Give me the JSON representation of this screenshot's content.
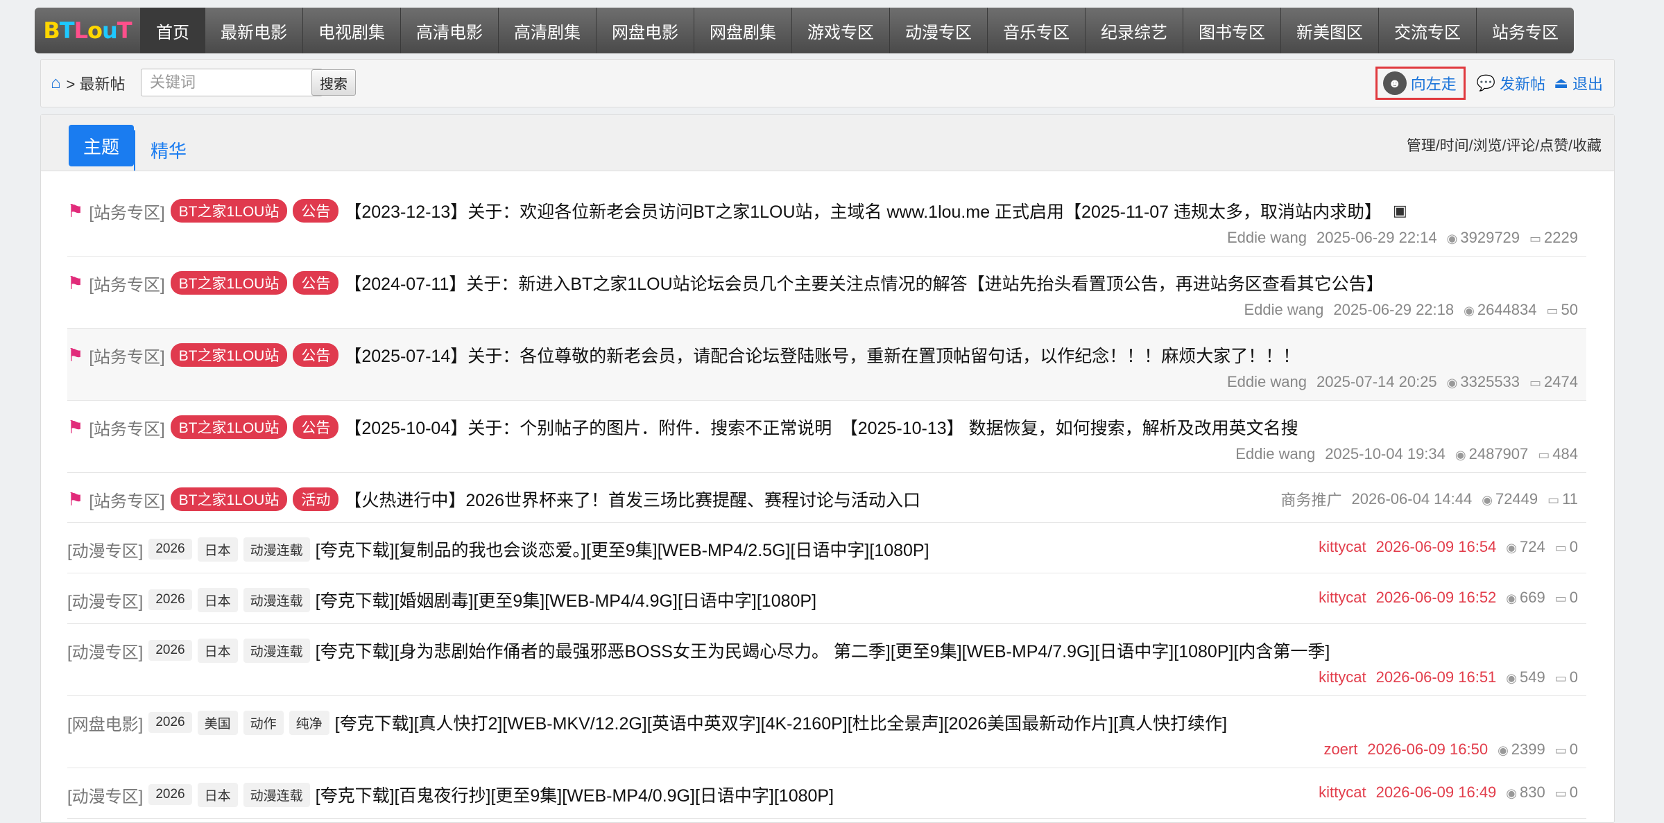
{
  "nav": {
    "items": [
      "首页",
      "最新电影",
      "电视剧集",
      "高清电影",
      "高清剧集",
      "网盘电影",
      "网盘剧集",
      "游戏专区",
      "动漫专区",
      "音乐专区",
      "纪录综艺",
      "图书专区",
      "新美图区",
      "交流专区",
      "站务专区"
    ]
  },
  "toolbar": {
    "breadcrumb": "> 最新帖",
    "search_placeholder": "关键词",
    "search_button": "搜索",
    "link_left": "向左走",
    "link_post": "发新帖",
    "link_logout": "退出"
  },
  "tabs": {
    "active": "主题",
    "other": "精华",
    "sort_links": "管理/时间/浏览/评论/点赞/收藏"
  },
  "threads": [
    {
      "forum": "[站务专区]",
      "pill": "BT之家1LOU站",
      "type": "公告",
      "title": "【2023-12-13】关于：欢迎各位新老会员访问BT之家1LOU站，主域名 www.1lou.me 正式启用【2025-11-07 违规太多，取消站内求助】",
      "author": "Eddie wang",
      "time": "2025-06-29 22:14",
      "views": "3929729",
      "replies": "2229"
    },
    {
      "forum": "[站务专区]",
      "pill": "BT之家1LOU站",
      "type": "公告",
      "title": "【2024-07-11】关于：新进入BT之家1LOU站论坛会员几个主要关注点情况的解答【进站先抬头看置顶公告，再进站务区查看其它公告】",
      "author": "Eddie wang",
      "time": "2025-06-29 22:18",
      "views": "2644834",
      "replies": "50"
    },
    {
      "forum": "[站务专区]",
      "pill": "BT之家1LOU站",
      "type": "公告",
      "title": "【2025-07-14】关于：各位尊敬的新老会员，请配合论坛登陆账号，重新在置顶帖留句话，以作纪念！！！麻烦大家了！！！",
      "author": "Eddie wang",
      "time": "2025-07-14 20:25",
      "views": "3325533",
      "replies": "2474"
    },
    {
      "forum": "[站务专区]",
      "pill": "BT之家1LOU站",
      "type": "公告",
      "title": "【2025-10-04】关于：个别帖子的图片．附件．搜索不正常说明　【2025-10-13】 数据恢复，如何搜索，解析及改用英文名搜",
      "author": "Eddie wang",
      "time": "2025-10-04 19:34",
      "views": "2487907",
      "replies": "484"
    },
    {
      "forum": "[站务专区]",
      "pill": "BT之家1LOU站",
      "type": "活动",
      "title": "【火热进行中】2026世界杯来了！首发三场比赛提醒、赛程讨论与活动入口",
      "author": "商务推广",
      "time": "2026-06-04 14:44",
      "views": "72449",
      "replies": "11"
    },
    {
      "forum": "[动漫专区]",
      "tags": [
        "2026",
        "日本",
        "动漫连载"
      ],
      "title": "[夸克下载][复制品的我也会谈恋爱。][更至9集][WEB-MP4/2.5G][日语中字][1080P]",
      "author": "kittycat",
      "time": "2026-06-09 16:54",
      "views": "724",
      "replies": "0"
    },
    {
      "forum": "[动漫专区]",
      "tags": [
        "2026",
        "日本",
        "动漫连载"
      ],
      "title": "[夸克下载][婚姻剧毒][更至9集][WEB-MP4/4.9G][日语中字][1080P]",
      "author": "kittycat",
      "time": "2026-06-09 16:52",
      "views": "669",
      "replies": "0"
    },
    {
      "forum": "[动漫专区]",
      "tags": [
        "2026",
        "日本",
        "动漫连载"
      ],
      "title": "[夸克下载][身为悲剧始作俑者的最强邪恶BOSS女王为民竭心尽力。 第二季][更至9集][WEB-MP4/7.9G][日语中字][1080P][内含第一季]",
      "author": "kittycat",
      "time": "2026-06-09 16:51",
      "views": "549",
      "replies": "0"
    },
    {
      "forum": "[网盘电影]",
      "tags": [
        "2026",
        "美国",
        "动作",
        "纯净"
      ],
      "title": "[夸克下载][真人快打2][WEB-MKV/12.2G][英语中英双字][4K-2160P][杜比全景声][2026美国最新动作片][真人快打续作]",
      "author": "zoert",
      "time": "2026-06-09 16:50",
      "views": "2399",
      "replies": "0"
    },
    {
      "forum": "[动漫专区]",
      "tags": [
        "2026",
        "日本",
        "动漫连载"
      ],
      "title": "[夸克下载][百鬼夜行抄][更至9集][WEB-MP4/0.9G][日语中字][1080P]",
      "author": "kittycat",
      "time": "2026-06-09 16:49",
      "views": "830",
      "replies": "0"
    }
  ]
}
